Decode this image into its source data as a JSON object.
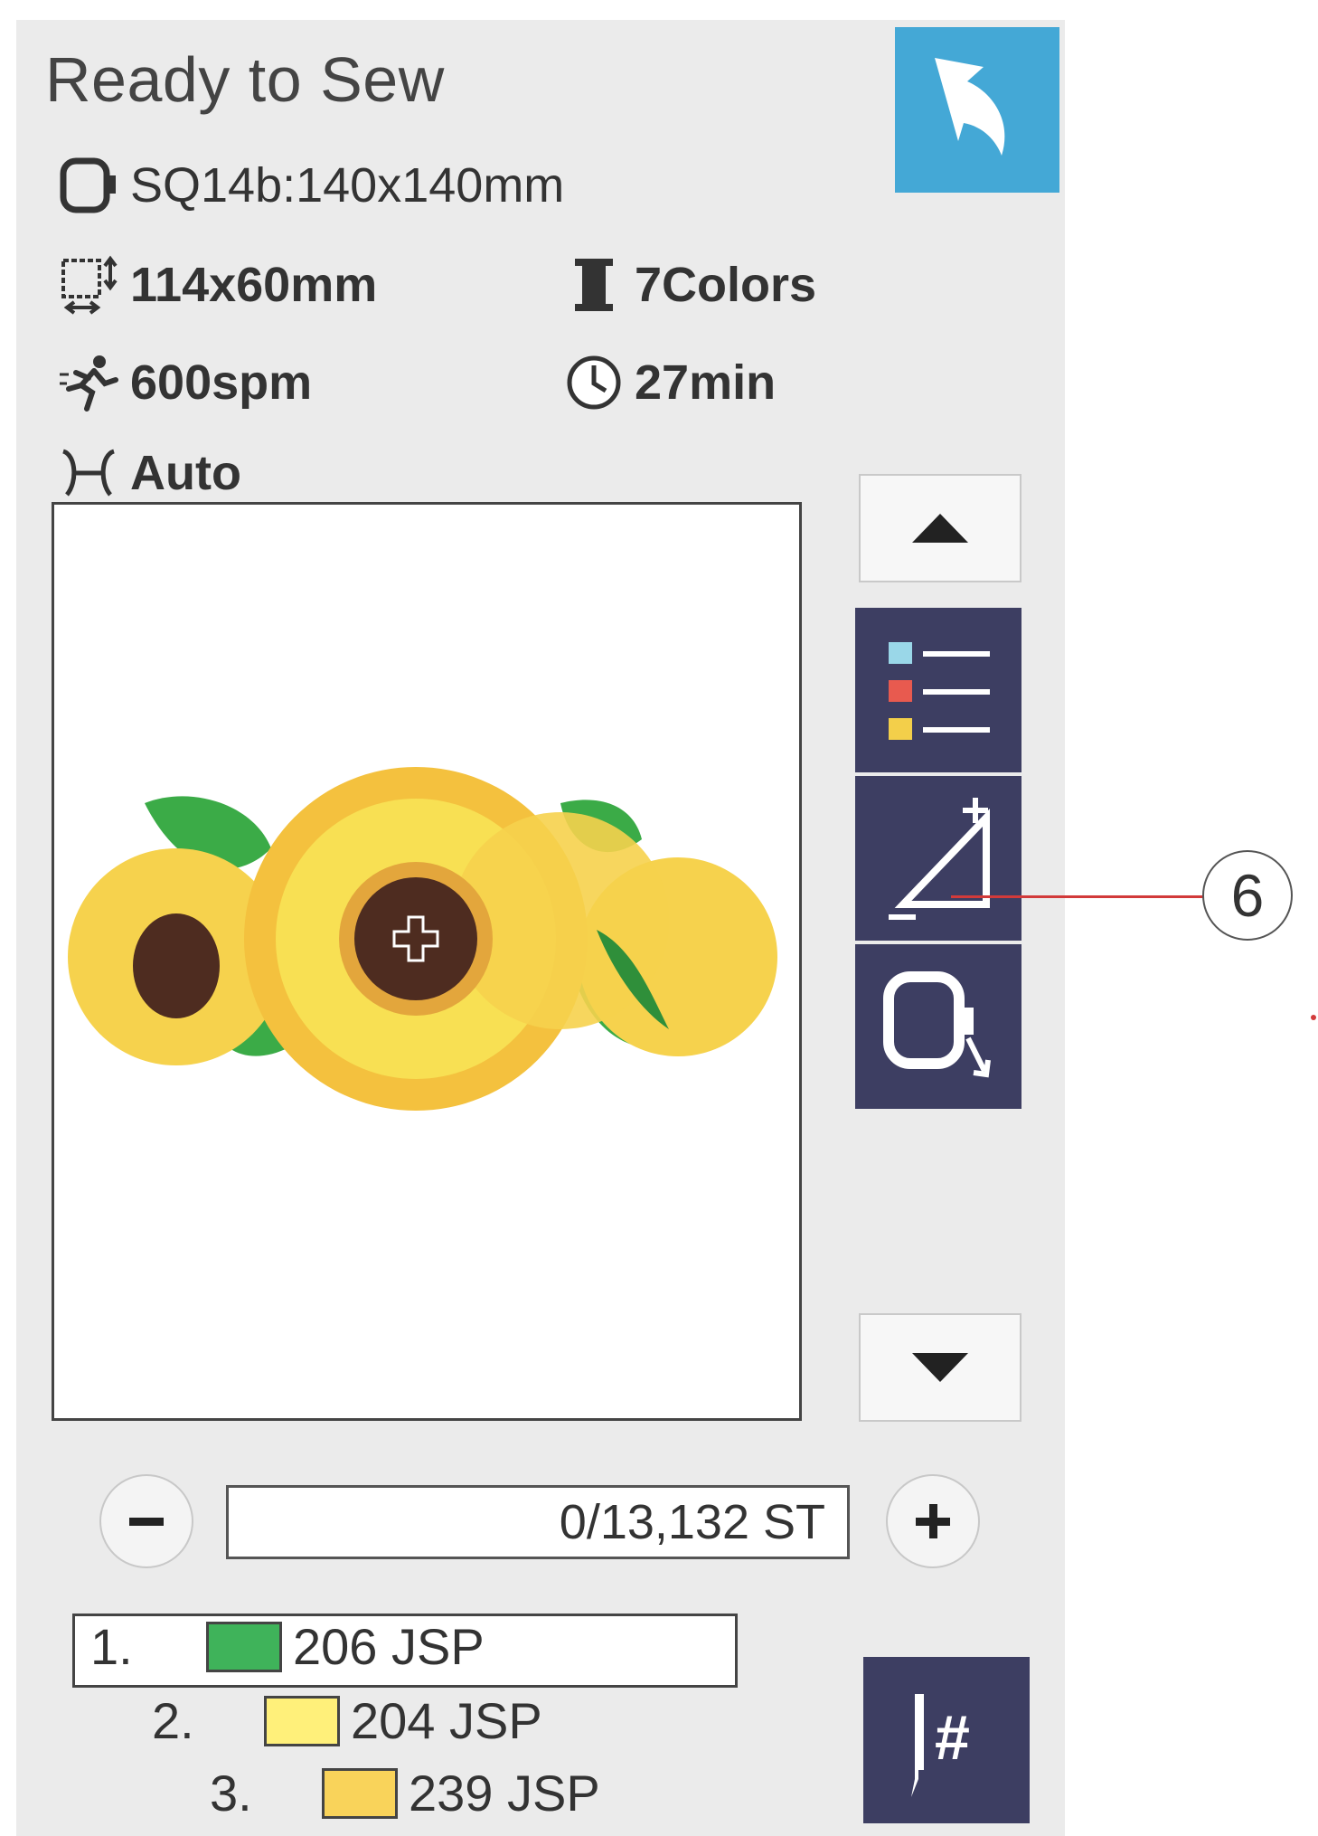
{
  "screen": {
    "title": "Ready to Sew"
  },
  "info": {
    "hoop": "SQ14b:140x140mm",
    "design_size": "114x60mm",
    "colors": "7Colors",
    "speed": "600spm",
    "time": "27min",
    "thread_cut": "Auto"
  },
  "stitch_counter": {
    "value": "0/13,132 ST"
  },
  "color_list": [
    {
      "num": "1.",
      "code": "206 JSP",
      "color": "#3fb35a"
    },
    {
      "num": "2.",
      "code": "204 JSP",
      "color": "#fff07a"
    },
    {
      "num": "3.",
      "code": "239 JSP",
      "color": "#f9d35a"
    }
  ],
  "callout": {
    "label": "6"
  },
  "icons": {
    "back": "back-arrow-icon",
    "hoop": "hoop-icon",
    "size": "design-size-icon",
    "spool": "thread-spool-icon",
    "speed": "running-figure-icon",
    "clock": "clock-icon",
    "scissors": "thread-cut-icon",
    "up": "triangle-up-icon",
    "down": "triangle-down-icon",
    "color_list": "color-list-icon",
    "tension": "tension-adjust-icon",
    "hoop_move": "hoop-move-icon",
    "needle": "needle-number-icon",
    "minus": "minus-icon",
    "plus": "plus-icon"
  }
}
